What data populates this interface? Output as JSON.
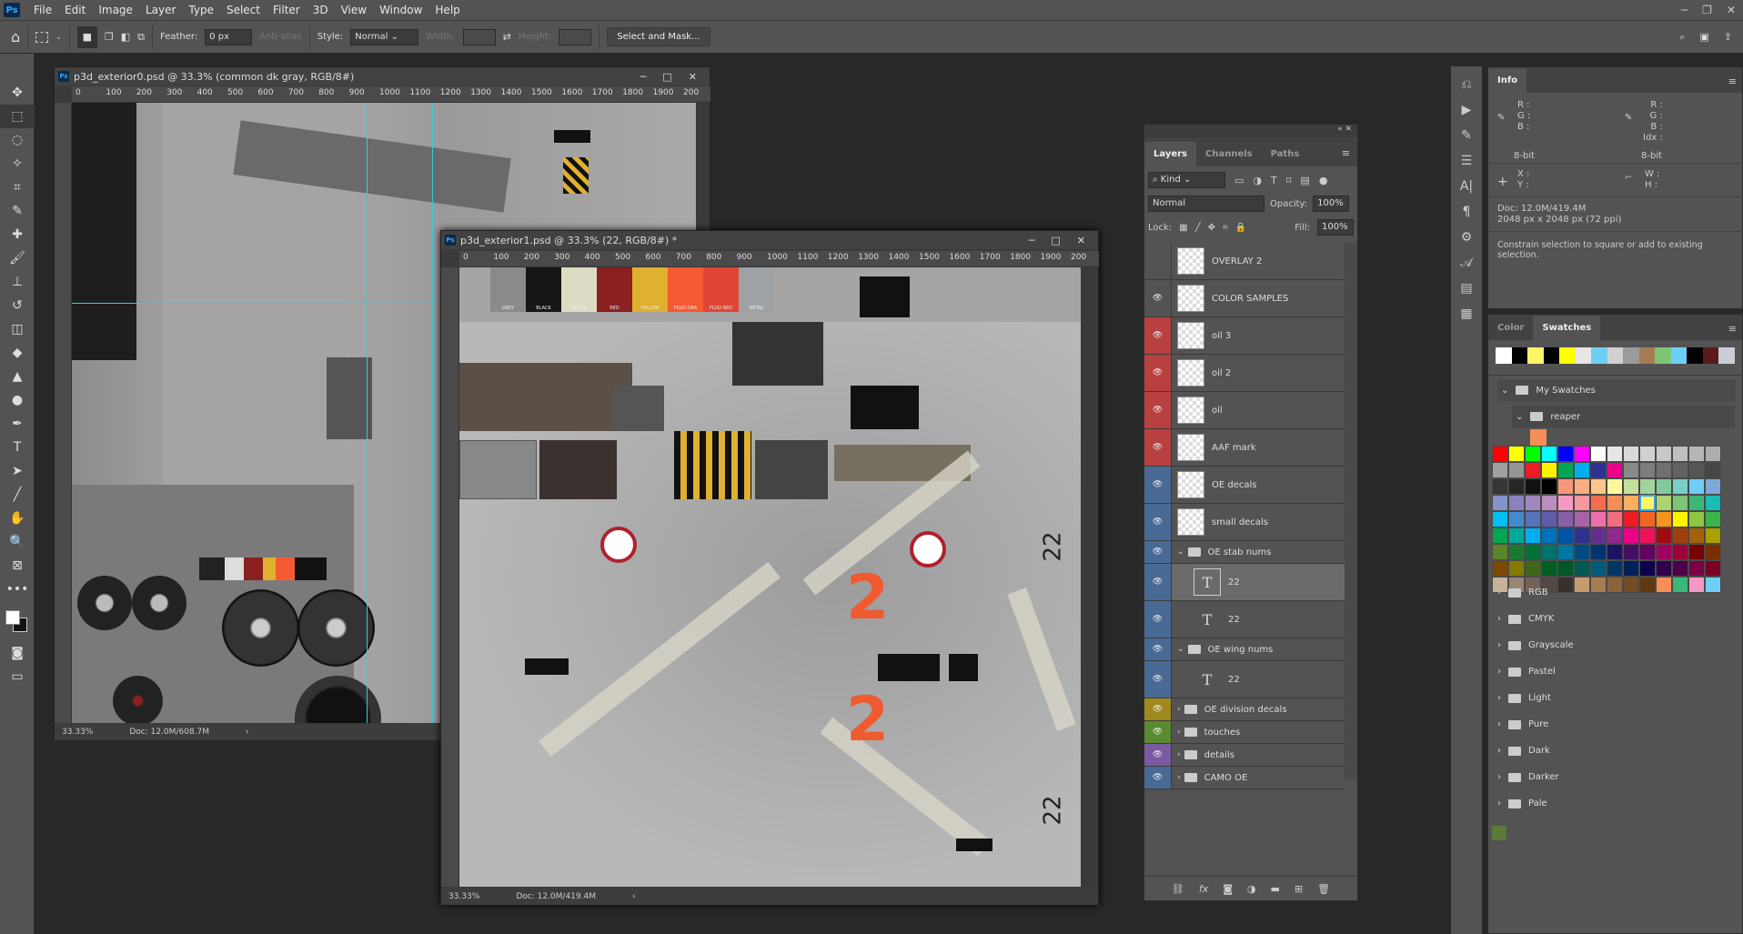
{
  "menu": {
    "items": [
      "File",
      "Edit",
      "Image",
      "Layer",
      "Type",
      "Select",
      "Filter",
      "3D",
      "View",
      "Window",
      "Help"
    ]
  },
  "options": {
    "feather_label": "Feather:",
    "feather_value": "0 px",
    "antialias": "Anti-alias",
    "style_label": "Style:",
    "style_value": "Normal",
    "width_label": "Width:",
    "height_label": "Height:",
    "select_mask": "Select and Mask..."
  },
  "doc1": {
    "title": "p3d_exterior0.psd @ 33.3% (common dk gray, RGB/8#)",
    "zoom": "33.33%",
    "doc": "Doc: 12.0M/608.7M"
  },
  "doc2": {
    "title": "p3d_exterior1.psd @ 33.3% (22, RGB/8#) *",
    "zoom": "33.33%",
    "doc": "Doc: 12.0M/419.4M",
    "strip": [
      {
        "label": "GREY",
        "color": "#8a8a8a"
      },
      {
        "label": "BLACK",
        "color": "#161616"
      },
      {
        "label": "WHITE",
        "color": "#dcdcc4"
      },
      {
        "label": "RED",
        "color": "#8b2020"
      },
      {
        "label": "YELLOW",
        "color": "#e0b030"
      },
      {
        "label": "FLUO ORA",
        "color": "#f65a32"
      },
      {
        "label": "FLUO RED",
        "color": "#e04535"
      },
      {
        "label": "METAL",
        "color": "#9ea2a4"
      }
    ],
    "num1": "2",
    "num2": "2",
    "side1": "22",
    "side2": "22"
  },
  "ruler_ticks": [
    "0",
    "100",
    "200",
    "300",
    "400",
    "500",
    "600",
    "700",
    "800",
    "900",
    "1000",
    "1100",
    "1200",
    "1300",
    "1400",
    "1500",
    "1600",
    "1700",
    "1800",
    "1900",
    "200"
  ],
  "layers_panel": {
    "tabs": [
      "Layers",
      "Channels",
      "Paths"
    ],
    "kind": "Kind",
    "blend": "Normal",
    "opacity_label": "Opacity:",
    "opacity": "100%",
    "lock_label": "Lock:",
    "fill_label": "Fill:",
    "fill": "100%",
    "layers": [
      {
        "name": "OVERLAY 2",
        "type": "layer",
        "visible": false,
        "tag": ""
      },
      {
        "name": "COLOR SAMPLES",
        "type": "layer",
        "visible": true,
        "tag": ""
      },
      {
        "name": "oil 3",
        "type": "layer",
        "visible": true,
        "tag": "#b84040"
      },
      {
        "name": "oil 2",
        "type": "layer",
        "visible": true,
        "tag": "#b84040"
      },
      {
        "name": "oil",
        "type": "layer",
        "visible": true,
        "tag": "#b84040"
      },
      {
        "name": "AAF mark",
        "type": "layer",
        "visible": true,
        "tag": "#b84040"
      },
      {
        "name": "OE decals",
        "type": "layer",
        "visible": true,
        "tag": "#4a6a96"
      },
      {
        "name": "small decals",
        "type": "layer",
        "visible": true,
        "tag": "#4a6a96"
      },
      {
        "name": "OE stab nums",
        "type": "group-open",
        "visible": true,
        "tag": "#4a6a96"
      },
      {
        "name": "22",
        "type": "text",
        "visible": true,
        "tag": "#4a6a96",
        "selected": true
      },
      {
        "name": "22",
        "type": "text",
        "visible": true,
        "tag": "#4a6a96"
      },
      {
        "name": "OE wing nums",
        "type": "group-open",
        "visible": true,
        "tag": "#4a6a96"
      },
      {
        "name": "22",
        "type": "text",
        "visible": true,
        "tag": "#4a6a96"
      },
      {
        "name": "OE division decals",
        "type": "group",
        "visible": true,
        "tag": "#a08a20"
      },
      {
        "name": "touches",
        "type": "group",
        "visible": true,
        "tag": "#5a8a30"
      },
      {
        "name": "details",
        "type": "group",
        "visible": true,
        "tag": "#7a5aa0"
      },
      {
        "name": "CAMO OE",
        "type": "group",
        "visible": true,
        "tag": "#4a6a96"
      }
    ]
  },
  "info": {
    "tab": "Info",
    "r": "R :",
    "g": "G :",
    "b": "B :",
    "idx": "Idx :",
    "bit1": "8-bit",
    "bit2": "8-bit",
    "x": "X :",
    "y": "Y :",
    "w": "W :",
    "h": "H :",
    "doc": "Doc: 12.0M/419.4M",
    "size": "2048 px x 2048 px (72 ppi)",
    "hint": "Constrain selection to square or add to existing selection."
  },
  "swatches": {
    "tabs": [
      "Color",
      "Swatches"
    ],
    "my_swatches": "My Swatches",
    "reaper": "reaper",
    "recent": [
      "#ffffff",
      "#000000",
      "#fff467",
      "#000000",
      "#ffff00",
      "#e6e6e6",
      "#6ecff6",
      "#d0d0d0",
      "#9b9b9b",
      "#a67c52",
      "#7cc576",
      "#6ecff6",
      "#000000",
      "#5c1a1a",
      "#c8cdd8"
    ],
    "reaper_colors": [
      "#f68e56"
    ],
    "grid": [
      "#ff0000",
      "#ffff00",
      "#00ff00",
      "#00ffff",
      "#0000ff",
      "#ff00ff",
      "#ffffff",
      "#e6e6e6",
      "#d9d9d9",
      "#d0d0d0",
      "#c8c8c8",
      "#bfbfbf",
      "#b6b6b6",
      "#adadad",
      "#a0a0a0",
      "#959595",
      "#ed1c24",
      "#fff200",
      "#00a651",
      "#00aeef",
      "#2e3192",
      "#ec008c",
      "#898989",
      "#7d7d7d",
      "#707070",
      "#626262",
      "#555555",
      "#464646",
      "#363636",
      "#262626",
      "#111111",
      "#000000",
      "#f7977a",
      "#f9ad81",
      "#fdc68a",
      "#fff79a",
      "#c4df9b",
      "#a2d39c",
      "#82ca9d",
      "#7bcdc8",
      "#6ecff6",
      "#7ea7d8",
      "#8493ca",
      "#8882be",
      "#a187be",
      "#bc8dbf",
      "#f49ac2",
      "#f6989d",
      "#f26c4f",
      "#f68e56",
      "#fbaf5d",
      "#fff467",
      "#acd372",
      "#7cc576",
      "#3bb878",
      "#1abbb4",
      "#00bff3",
      "#438ccb",
      "#5574b9",
      "#605ca8",
      "#855fa8",
      "#a763a8",
      "#f06ea9",
      "#f26d7d",
      "#ed1c24",
      "#f26522",
      "#f7941d",
      "#fff200",
      "#8dc73f",
      "#39b54a",
      "#00a651",
      "#00a99d",
      "#00aeef",
      "#0072bc",
      "#0054a6",
      "#2e3192",
      "#662d91",
      "#92278f",
      "#ec008c",
      "#ed145b",
      "#9e0b0f",
      "#a0410d",
      "#a36209",
      "#aba000",
      "#598527",
      "#1a7b30",
      "#007236",
      "#00746b",
      "#0076a3",
      "#004b80",
      "#003471",
      "#1b1464",
      "#440e62",
      "#630460",
      "#9e005d",
      "#9e0039",
      "#790000",
      "#7b2e00",
      "#7d4900",
      "#827b00",
      "#406618",
      "#005e20",
      "#005826",
      "#005952",
      "#005b7f",
      "#003663",
      "#002157",
      "#0d004c",
      "#32004b",
      "#4b0049",
      "#7b0046",
      "#7a0026",
      "#c7b299",
      "#998675",
      "#736357",
      "#534741",
      "#37302d",
      "#c69c6d",
      "#a67c52",
      "#8c6239",
      "#754c24",
      "#603913",
      "#f68e56",
      "#3bb878",
      "#f49ac2",
      "#6ecff6"
    ],
    "selected_index": 51,
    "folders": [
      "RGB",
      "CMYK",
      "Grayscale",
      "Pastel",
      "Light",
      "Pure",
      "Dark",
      "Darker",
      "Pale"
    ],
    "extra": "#5a7a3a"
  },
  "colors": {
    "accent": "#31a8ff",
    "guide": "#3ec8d8"
  }
}
